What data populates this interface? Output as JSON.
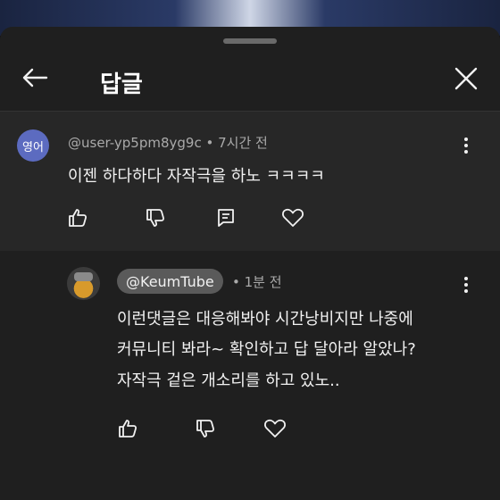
{
  "header": {
    "title": "답글"
  },
  "parent_comment": {
    "avatar_text": "영어",
    "author": "@user-yp5pm8yg9c",
    "separator": " • ",
    "time": "7시간 전",
    "text": "이젠 하다하다 자작극을 하노 ㅋㅋㅋㅋ"
  },
  "reply": {
    "author": "@KeumTube",
    "separator": " • ",
    "time": "1분 전",
    "lines": [
      "이런댓글은 대응해봐야 시간낭비지만 나중에",
      "커뮤니티 봐라~ 확인하고 답 달아라 알았나?",
      "자작극 겉은 개소리를 하고 있노.."
    ]
  }
}
